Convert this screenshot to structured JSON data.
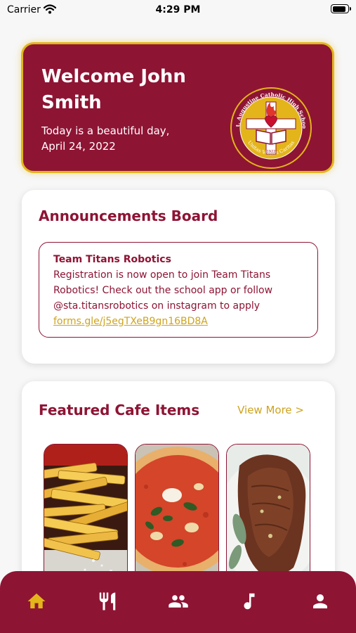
{
  "status_bar": {
    "carrier": "Carrier",
    "time": "4:29 PM",
    "battery_level": 0.9
  },
  "welcome": {
    "title": "Welcome John Smith",
    "subtitle": "Today is a beautiful day, April 24, 2022",
    "seal": {
      "ring_text": "St. Augustine Catholic High School",
      "motto": "Unitas   Veritas   Caritas",
      "year": "1922",
      "icon": "school-seal-icon"
    }
  },
  "announcements": {
    "title": "Announcements Board",
    "items": [
      {
        "title": "Team Titans Robotics",
        "body": "Registration is now open to join Team Titans Robotics!  Check out the school app or follow @sta.titansrobotics on instagram to apply",
        "link": "forms.gle/j5egTXeB9gn16BD8A"
      }
    ]
  },
  "cafe": {
    "title": "Featured Cafe Items",
    "view_more": "View More >",
    "items": [
      {
        "name": "",
        "image": "french-fries-image"
      },
      {
        "name": "",
        "image": "pizza-image"
      },
      {
        "name": "",
        "image": "steak-image"
      }
    ]
  },
  "tabs": [
    {
      "name": "home",
      "icon": "home-icon",
      "active": true
    },
    {
      "name": "dining",
      "icon": "utensils-icon",
      "active": false
    },
    {
      "name": "people",
      "icon": "people-icon",
      "active": false
    },
    {
      "name": "music",
      "icon": "music-note-icon",
      "active": false
    },
    {
      "name": "profile",
      "icon": "person-icon",
      "active": false
    }
  ],
  "colors": {
    "primary": "#8e1434",
    "accent": "#e3b51a",
    "accent_text": "#cfa31e",
    "background": "#f7f7f7"
  }
}
